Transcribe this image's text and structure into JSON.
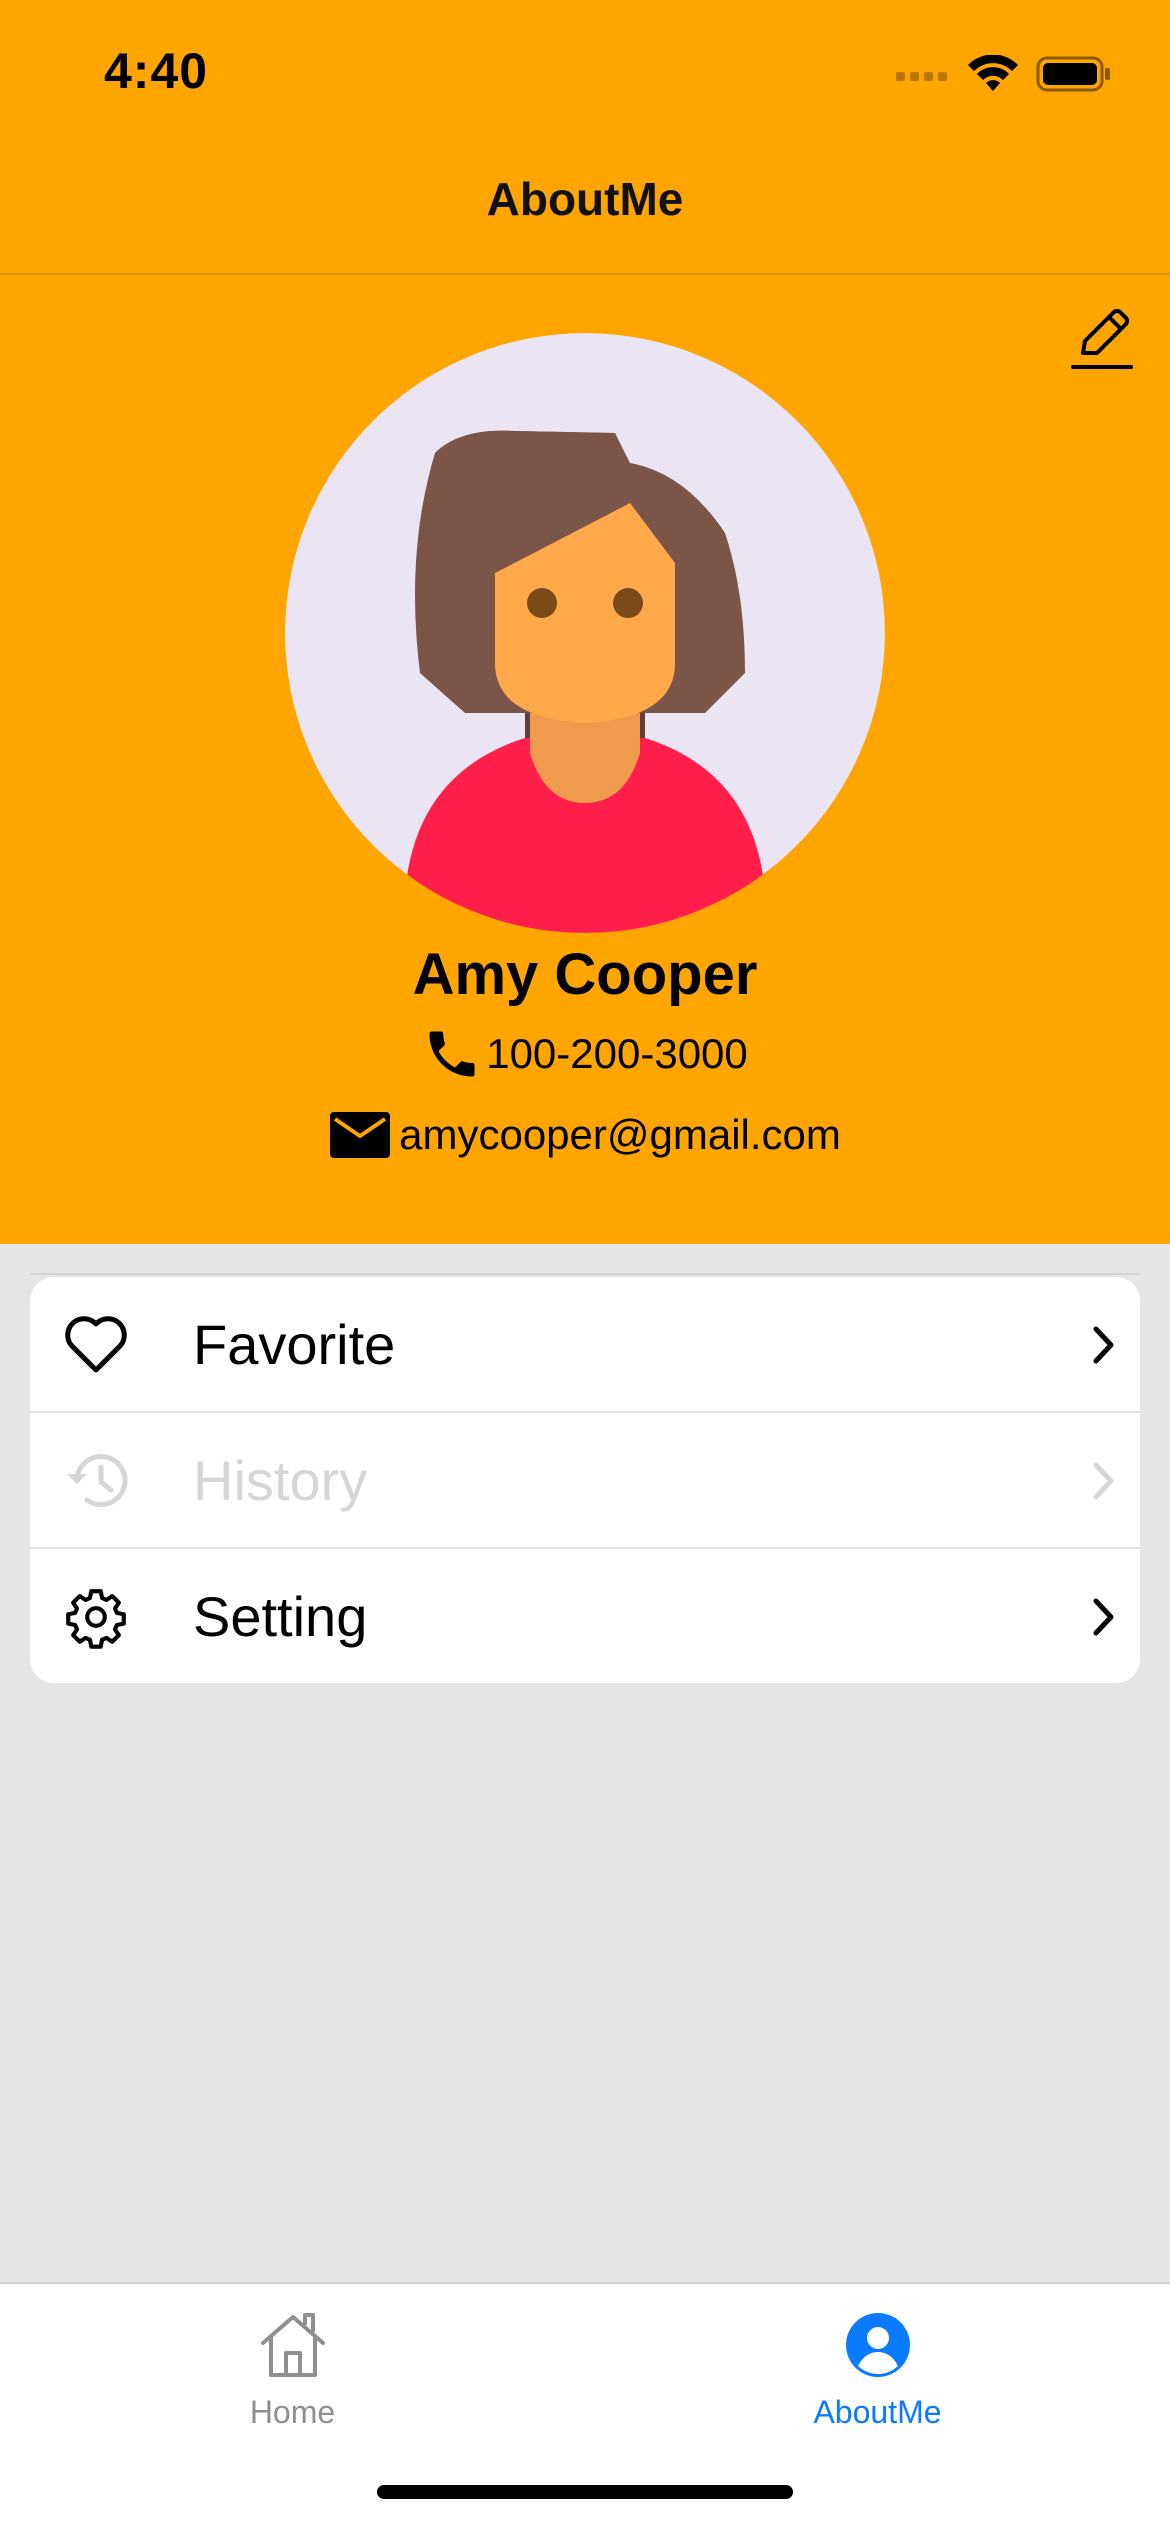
{
  "status_bar": {
    "time": "4:40"
  },
  "nav": {
    "title": "AboutMe"
  },
  "profile": {
    "name": "Amy Cooper",
    "phone": "100-200-3000",
    "email": "amycooper@gmail.com"
  },
  "menu": {
    "items": [
      {
        "label": "Favorite",
        "icon": "heart-icon",
        "enabled": true
      },
      {
        "label": "History",
        "icon": "history-icon",
        "enabled": false
      },
      {
        "label": "Setting",
        "icon": "gear-icon",
        "enabled": true
      }
    ]
  },
  "tabbar": {
    "tabs": [
      {
        "label": "Home",
        "icon": "home-icon",
        "active": false
      },
      {
        "label": "AboutMe",
        "icon": "person-circle-icon",
        "active": true
      }
    ]
  },
  "colors": {
    "header": "#ffa500",
    "background": "#e5e5e5",
    "active_tab": "#0a7aff",
    "inactive_tab": "#8e8e93",
    "disabled_text": "#d6d6d6"
  }
}
